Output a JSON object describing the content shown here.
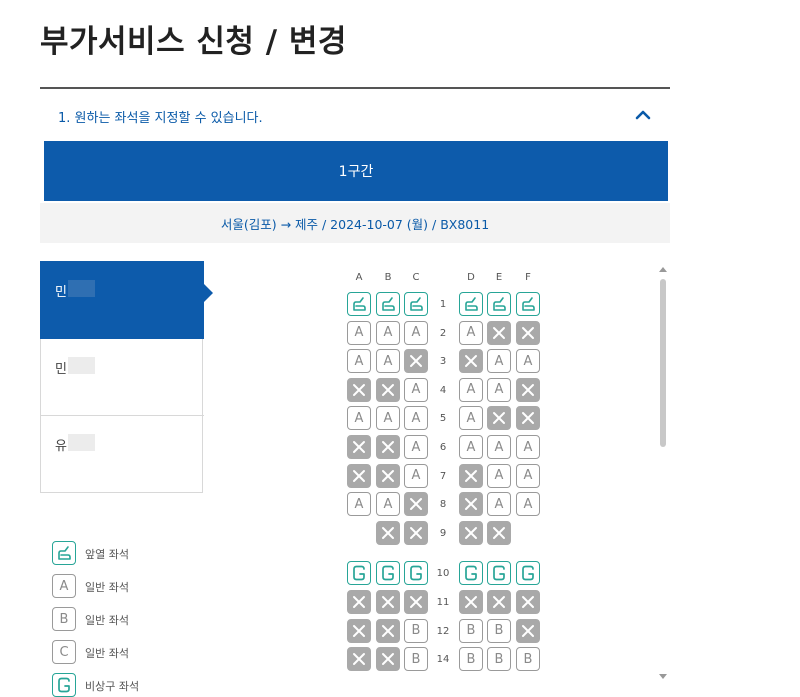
{
  "page": {
    "title": "부가서비스 신청 / 변경"
  },
  "accordion": {
    "title": "1. 원하는 좌석을 지정할 수 있습니다.",
    "chevron_icon": "chevron-up-icon"
  },
  "segment": {
    "label": "1구간"
  },
  "route": {
    "text": "서울(김포) → 제주 / 2024-10-07 (월) / BX8011"
  },
  "passengers": [
    {
      "name": "민",
      "selected": true
    },
    {
      "name": "민",
      "selected": false
    },
    {
      "name": "유",
      "selected": false
    }
  ],
  "seatmap": {
    "columns": [
      "A",
      "B",
      "C",
      "D",
      "E",
      "F"
    ],
    "rows": [
      {
        "num": "1",
        "seats": [
          "F",
          "F",
          "F",
          "F",
          "F",
          "F"
        ]
      },
      {
        "num": "2",
        "seats": [
          "A",
          "A",
          "A",
          "A",
          "X",
          "X"
        ]
      },
      {
        "num": "3",
        "seats": [
          "A",
          "A",
          "X",
          "X",
          "A",
          "A"
        ]
      },
      {
        "num": "4",
        "seats": [
          "X",
          "X",
          "A",
          "A",
          "A",
          "X"
        ]
      },
      {
        "num": "5",
        "seats": [
          "A",
          "A",
          "A",
          "A",
          "X",
          "X"
        ]
      },
      {
        "num": "6",
        "seats": [
          "X",
          "X",
          "A",
          "A",
          "A",
          "A"
        ]
      },
      {
        "num": "7",
        "seats": [
          "X",
          "X",
          "A",
          "X",
          "A",
          "A"
        ]
      },
      {
        "num": "8",
        "seats": [
          "A",
          "A",
          "X",
          "X",
          "A",
          "A"
        ]
      },
      {
        "num": "9",
        "seats": [
          "",
          "X",
          "X",
          "X",
          "X",
          ""
        ]
      },
      {
        "num": "10",
        "seats": [
          "E",
          "E",
          "E",
          "E",
          "E",
          "E"
        ]
      },
      {
        "num": "11",
        "seats": [
          "X",
          "X",
          "X",
          "X",
          "X",
          "X"
        ]
      },
      {
        "num": "12",
        "seats": [
          "X",
          "X",
          "B",
          "B",
          "B",
          "X"
        ]
      },
      {
        "num": "14",
        "seats": [
          "X",
          "X",
          "B",
          "B",
          "B",
          "B"
        ]
      }
    ]
  },
  "legend": [
    {
      "type": "front",
      "letter": "",
      "label": "앞열 좌석"
    },
    {
      "type": "general",
      "letter": "A",
      "label": "일반 좌석"
    },
    {
      "type": "general",
      "letter": "B",
      "label": "일반 좌석"
    },
    {
      "type": "general",
      "letter": "C",
      "label": "일반 좌석"
    },
    {
      "type": "exit",
      "letter": "",
      "label": "비상구 좌석"
    }
  ],
  "colors": {
    "brand_blue": "#0d5bab",
    "teal": "#27a597",
    "taken_gray": "#a9a9a9",
    "route_bg": "#f3f3f3"
  }
}
